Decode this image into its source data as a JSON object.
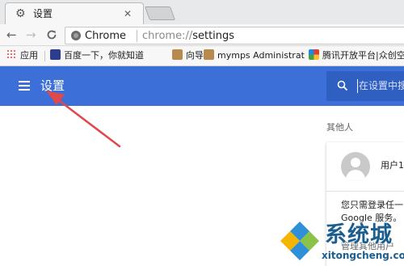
{
  "tab": {
    "title": "设置",
    "close_glyph": "✕",
    "icon": "gear-icon"
  },
  "toolbar": {
    "back_glyph": "←",
    "forward_glyph": "→",
    "reload_glyph": "C",
    "omnibox": {
      "site_label": "Chrome",
      "url_scheme": "chrome://",
      "url_path": "settings"
    }
  },
  "bookmarks": [
    {
      "label": "应用",
      "icon": "apps-icon"
    },
    {
      "label": "百度一下，你就知道",
      "icon": "baidu-paw-icon"
    },
    {
      "label": "向导网",
      "icon": "dog-icon"
    },
    {
      "label": "mymps Administrat",
      "icon": "dog-icon"
    },
    {
      "label": "腾讯开放平台|众创空",
      "icon": "tencent-icon"
    }
  ],
  "header": {
    "title": "设置",
    "search_placeholder": "在设置中搜",
    "background": "#3c6fd8",
    "annotation_arrow_color": "#e0484b"
  },
  "main": {
    "section_label": "其他人",
    "card": {
      "user_name": "用户1",
      "description_line1": "您只需登录任一",
      "description_line2": "Google 服务。",
      "link_label": "管理其他用户"
    }
  },
  "watermark": {
    "chinese": "系统城",
    "english": "xitongcheng.com"
  }
}
